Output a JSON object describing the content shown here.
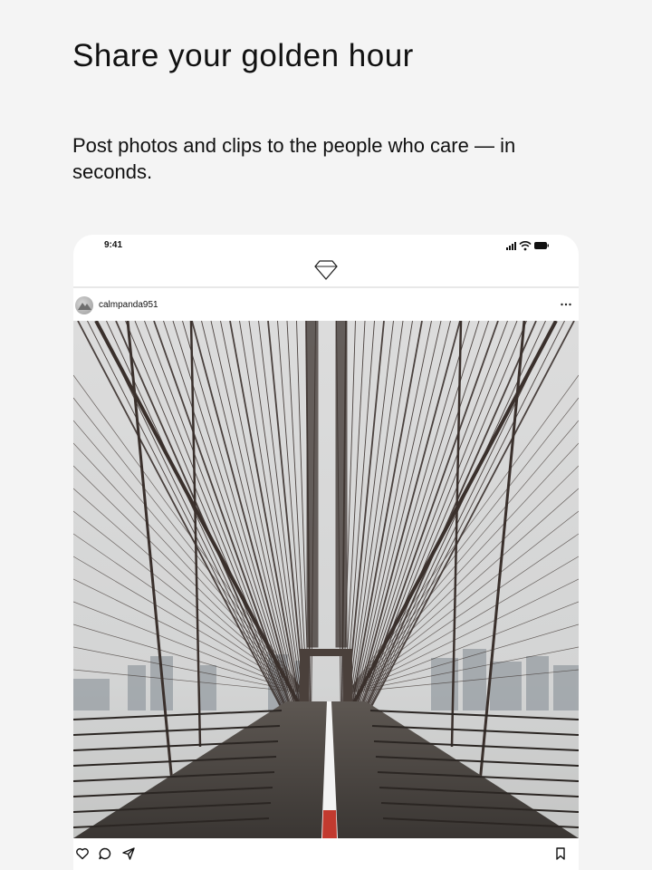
{
  "hero": {
    "headline": "Share your golden hour",
    "subline": "Post photos and clips to the people who care — in seconds."
  },
  "phone": {
    "status_time": "9:41",
    "status_icons": [
      "signal-icon",
      "wifi-icon",
      "battery-icon"
    ],
    "app_logo": "diamond-logo-icon",
    "post": {
      "username": "calmpanda951",
      "menu_icon": "more-horizontal-icon",
      "image_subject": "suspension bridge walkway with cables",
      "actions": [
        "heart-icon",
        "comment-icon",
        "send-icon",
        "bookmark-icon"
      ]
    }
  },
  "colors": {
    "background": "#f4f4f4",
    "card": "#ffffff",
    "text": "#111111",
    "walkway_line": "#ffffff",
    "walkway_red": "#c23a2f"
  }
}
